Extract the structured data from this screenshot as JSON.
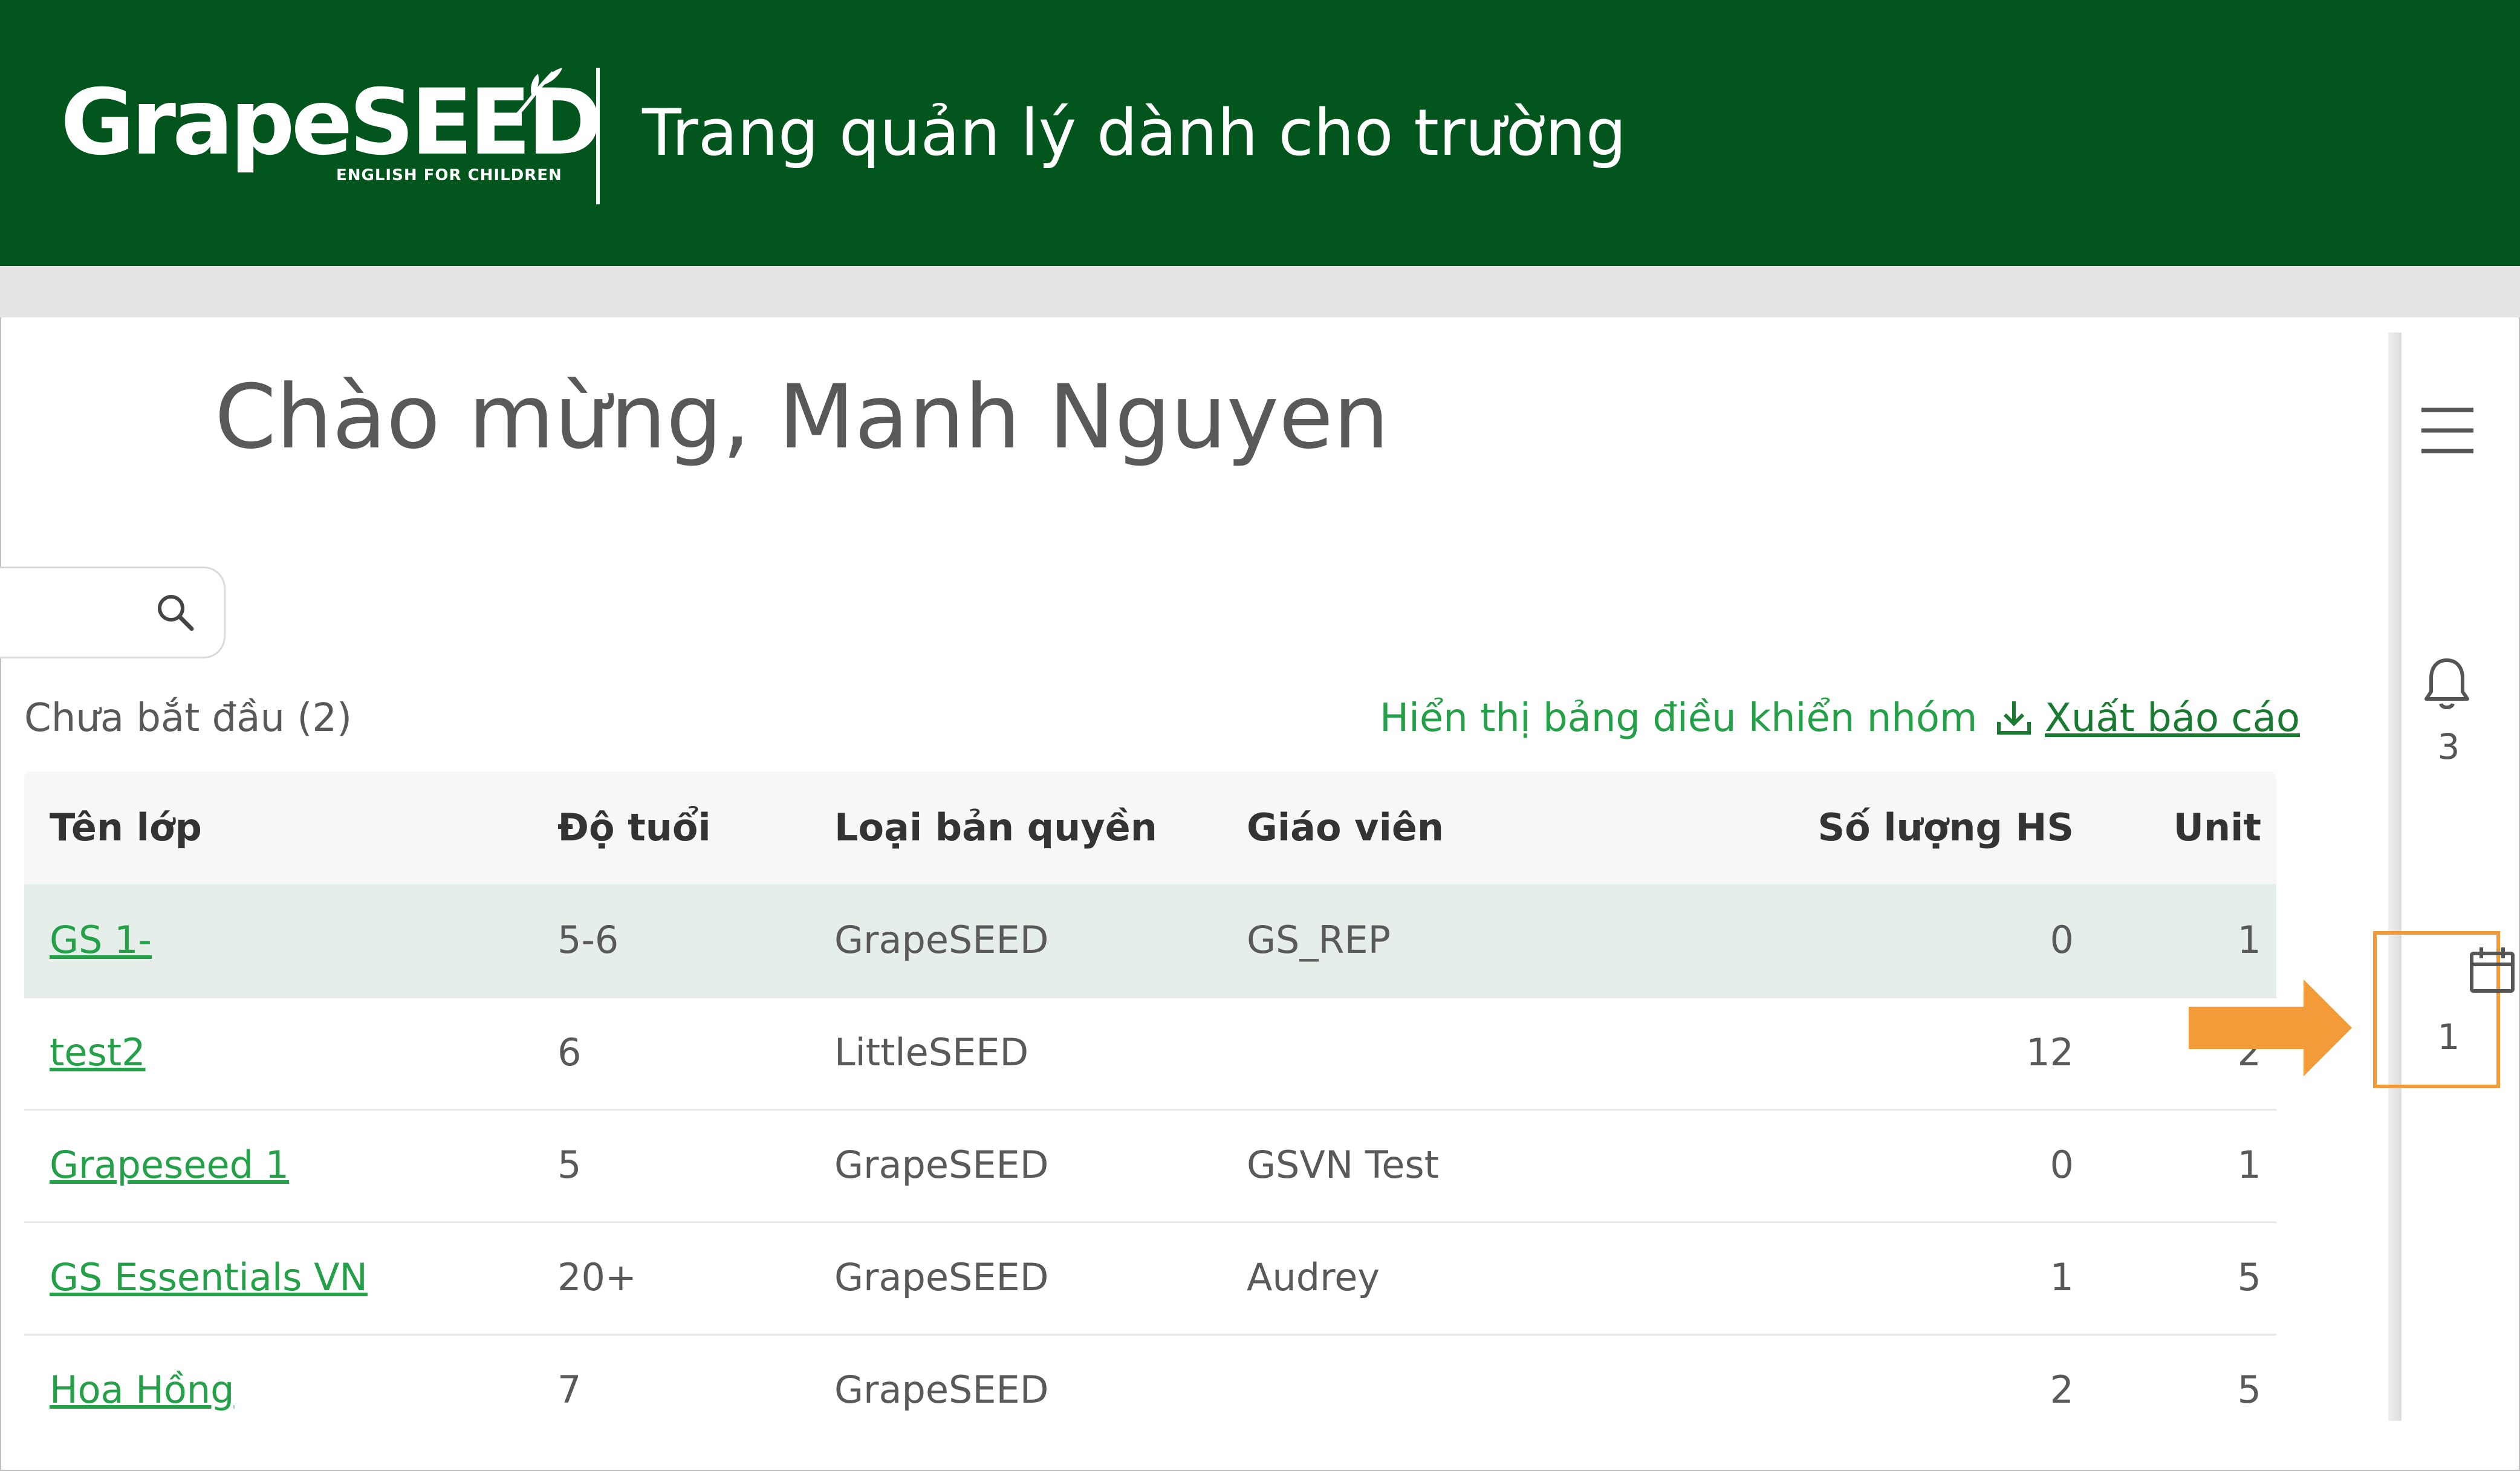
{
  "header": {
    "logo_text": "GrapeSEED",
    "logo_tagline": "ENGLISH FOR CHILDREN",
    "title": "Trang quản lý dành cho trường"
  },
  "welcome": "Chào mừng, Manh Nguyen",
  "search": {
    "placeholder": ""
  },
  "toolbar": {
    "status": "Chưa bắt đầu (2)",
    "show_dashboard": "Hiển thị bảng điều khiển nhóm",
    "export": "Xuất báo cáo"
  },
  "table": {
    "columns": [
      "Tên lớp",
      "Độ tuổi",
      "Loại bản quyền",
      "Giáo viên",
      "Số lượng HS",
      "Unit"
    ],
    "rows": [
      {
        "name": "GS 1-",
        "age": "5-6",
        "license": "GrapeSEED",
        "teacher": "GS_REP",
        "students": "0",
        "unit": "1"
      },
      {
        "name": "test2",
        "age": "6",
        "license": "LittleSEED",
        "teacher": "",
        "students": "12",
        "unit": "2"
      },
      {
        "name": "Grapeseed 1",
        "age": "5",
        "license": "GrapeSEED",
        "teacher": "GSVN Test",
        "students": "0",
        "unit": "1"
      },
      {
        "name": "GS Essentials VN ",
        "age": "20+",
        "license": "GrapeSEED",
        "teacher": "Audrey",
        "students": "1",
        "unit": "5"
      },
      {
        "name": "Hoa Hồng",
        "age": "7",
        "license": "GrapeSEED",
        "teacher": "",
        "students": "2",
        "unit": "5"
      }
    ]
  },
  "sidebar": {
    "notifications_count": "3",
    "calendar_count": "1"
  },
  "colors": {
    "brand_green": "#02561d",
    "link_green": "#23a048",
    "highlight_orange": "#f29b38"
  },
  "icons": [
    "menu-icon",
    "bell-icon",
    "calendar-icon",
    "search-icon",
    "download-icon",
    "arrow-right-icon"
  ]
}
